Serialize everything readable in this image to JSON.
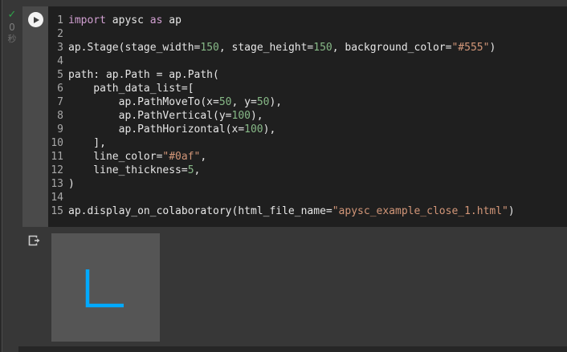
{
  "colors": {
    "keyword": "#d2a0d2",
    "number": "#87b987",
    "string": "#d29678",
    "text": "#e6e6e6",
    "line_number": "#a8a8a8",
    "check_green": "#2fa44a"
  },
  "gutter": {
    "check_icon": "✓",
    "execution_count": "0",
    "seconds_label": "秒"
  },
  "cell": {
    "run_button_icon": "play-icon",
    "code_lines": [
      {
        "n": "1",
        "tokens": [
          [
            "kw",
            "import"
          ],
          [
            "pl",
            " apysc "
          ],
          [
            "kw",
            "as"
          ],
          [
            "pl",
            " ap"
          ]
        ]
      },
      {
        "n": "2",
        "tokens": []
      },
      {
        "n": "3",
        "tokens": [
          [
            "pl",
            "ap.Stage(stage_width="
          ],
          [
            "num",
            "150"
          ],
          [
            "pl",
            ", stage_height="
          ],
          [
            "num",
            "150"
          ],
          [
            "pl",
            ", background_color="
          ],
          [
            "str",
            "\"#555\""
          ],
          [
            "pl",
            ")"
          ]
        ]
      },
      {
        "n": "4",
        "tokens": []
      },
      {
        "n": "5",
        "tokens": [
          [
            "pl",
            "path: ap.Path = ap.Path("
          ]
        ]
      },
      {
        "n": "6",
        "tokens": [
          [
            "pl",
            "    path_data_list=["
          ]
        ]
      },
      {
        "n": "7",
        "tokens": [
          [
            "pl",
            "        ap.PathMoveTo(x="
          ],
          [
            "num",
            "50"
          ],
          [
            "pl",
            ", y="
          ],
          [
            "num",
            "50"
          ],
          [
            "pl",
            "),"
          ]
        ]
      },
      {
        "n": "8",
        "tokens": [
          [
            "pl",
            "        ap.PathVertical(y="
          ],
          [
            "num",
            "100"
          ],
          [
            "pl",
            "),"
          ]
        ]
      },
      {
        "n": "9",
        "tokens": [
          [
            "pl",
            "        ap.PathHorizontal(x="
          ],
          [
            "num",
            "100"
          ],
          [
            "pl",
            "),"
          ]
        ]
      },
      {
        "n": "10",
        "tokens": [
          [
            "pl",
            "    ],"
          ]
        ]
      },
      {
        "n": "11",
        "tokens": [
          [
            "pl",
            "    line_color="
          ],
          [
            "str",
            "\"#0af\""
          ],
          [
            "pl",
            ","
          ]
        ]
      },
      {
        "n": "12",
        "tokens": [
          [
            "pl",
            "    line_thickness="
          ],
          [
            "num",
            "5"
          ],
          [
            "pl",
            ","
          ]
        ]
      },
      {
        "n": "13",
        "tokens": [
          [
            "pl",
            ")"
          ]
        ]
      },
      {
        "n": "14",
        "tokens": []
      },
      {
        "n": "15",
        "tokens": [
          [
            "pl",
            "ap.display_on_colaboratory(html_file_name="
          ],
          [
            "str",
            "\"apysc_example_close_1.html\""
          ],
          [
            "pl",
            ")"
          ]
        ]
      }
    ]
  },
  "output": {
    "icon": "export-output-icon",
    "stage": {
      "width": 150,
      "height": 150,
      "display_size": 135,
      "background_color": "#555555",
      "path": {
        "points": [
          [
            50,
            50
          ],
          [
            50,
            100
          ],
          [
            100,
            100
          ]
        ],
        "line_color": "#00aaff",
        "line_thickness": 5
      }
    }
  }
}
